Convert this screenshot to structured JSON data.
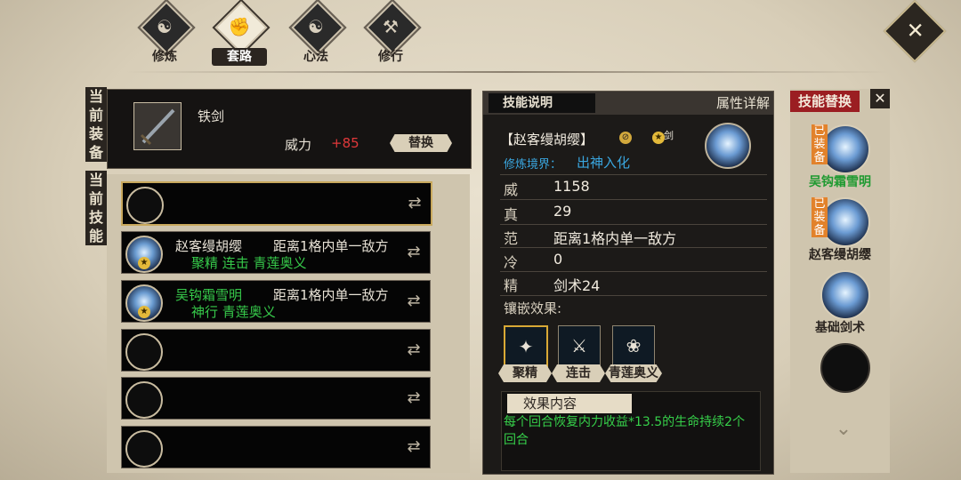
{
  "tabs": [
    {
      "label": "修炼",
      "active": false,
      "icon": "cultivate-icon"
    },
    {
      "label": "套路",
      "active": true,
      "icon": "fist-icon"
    },
    {
      "label": "心法",
      "active": false,
      "icon": "yinyang-icon"
    },
    {
      "label": "修行",
      "active": false,
      "icon": "scroll-icon"
    }
  ],
  "current_equip": {
    "side_label": [
      "当",
      "前",
      "装",
      "备"
    ],
    "weapon_name": "铁剑",
    "power_label": "威力",
    "power_value": "+85",
    "replace_label": "替换"
  },
  "current_skills": {
    "side_label": [
      "当",
      "前",
      "技",
      "能"
    ],
    "rows": [
      {
        "name": "",
        "range": "",
        "tags": "",
        "filled": false
      },
      {
        "name": "赵客缦胡缨",
        "range": "距离1格内单一敌方",
        "tags": "聚精 连击 青莲奥义",
        "filled": true
      },
      {
        "name": "吴钩霜雪明",
        "range": "距离1格内单一敌方",
        "tags": "神行 青莲奥义",
        "filled": true
      },
      {
        "name": "",
        "range": "",
        "tags": "",
        "filled": false
      },
      {
        "name": "",
        "range": "",
        "tags": "",
        "filled": false
      },
      {
        "name": "",
        "range": "",
        "tags": "",
        "filled": false
      }
    ]
  },
  "skill_detail": {
    "tab_active": "技能说明",
    "tab_other": "属性详解",
    "skill_name": "【赵客缦胡缨】",
    "weapon_tag": "剑",
    "realm_label": "修炼境界：",
    "realm_value": "出神入化",
    "stats": [
      {
        "k": "威",
        "v": "1158"
      },
      {
        "k": "真",
        "v": "29"
      },
      {
        "k": "范",
        "v": "距离1格内单一敌方"
      },
      {
        "k": "冷",
        "v": "0"
      },
      {
        "k": "精",
        "v": "剑术24"
      }
    ],
    "inlay_label": "镶嵌效果:",
    "gems": [
      {
        "label": "聚精",
        "active": true
      },
      {
        "label": "连击",
        "active": false
      },
      {
        "label": "青莲奥义",
        "active": false
      }
    ],
    "effect_title": "效果内容",
    "effect_text": "每个回合恢复内力收益*13.5的生命持续2个回合"
  },
  "skill_replace": {
    "title": "技能替换",
    "close": "✕",
    "items": [
      {
        "name": "吴钩霜雪明",
        "equipped": "已装备",
        "green": true
      },
      {
        "name": "赵客缦胡缨",
        "equipped": "已装备",
        "green": false
      },
      {
        "name": "基础剑术",
        "equipped": "",
        "green": false
      },
      {
        "name": "",
        "equipped": "",
        "green": false
      }
    ]
  },
  "colors": {
    "accent_green": "#36c94a",
    "power_red": "#e0383a",
    "realm_blue": "#3aa7e0",
    "replace_red": "#9b1e22"
  }
}
